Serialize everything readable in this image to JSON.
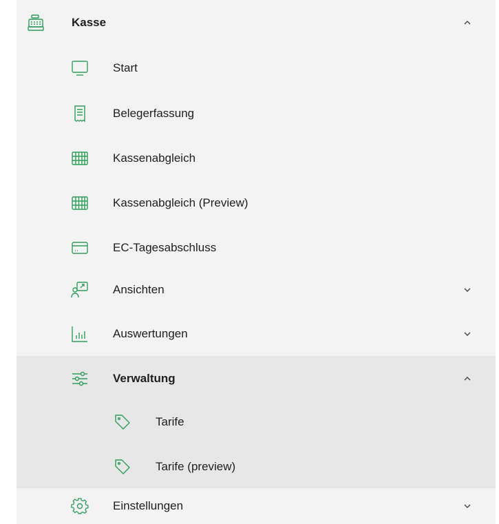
{
  "nav": {
    "section": {
      "label": "Kasse",
      "icon": "cash-register-icon",
      "expanded": true
    },
    "items": [
      {
        "label": "Start",
        "icon": "monitor-icon"
      },
      {
        "label": "Belegerfassung",
        "icon": "receipt-icon"
      },
      {
        "label": "Kassenabgleich",
        "icon": "abacus-icon"
      },
      {
        "label": "Kassenabgleich (Preview)",
        "icon": "abacus-icon"
      },
      {
        "label": "EC-Tagesabschluss",
        "icon": "card-icon"
      },
      {
        "label": "Ansichten",
        "icon": "presentation-icon",
        "expanded": false
      },
      {
        "label": "Auswertungen",
        "icon": "bar-chart-icon",
        "expanded": false
      },
      {
        "label": "Verwaltung",
        "icon": "sliders-icon",
        "expanded": true,
        "children": [
          {
            "label": "Tarife",
            "icon": "tag-icon"
          },
          {
            "label": "Tarife (preview)",
            "icon": "tag-icon"
          }
        ]
      },
      {
        "label": "Einstellungen",
        "icon": "gear-icon",
        "expanded": false
      }
    ]
  },
  "colors": {
    "accent": "#2e9e5b",
    "panel": "#f3f3f3",
    "selected_group": "#e7e7e7",
    "text": "#1f1f1f"
  }
}
